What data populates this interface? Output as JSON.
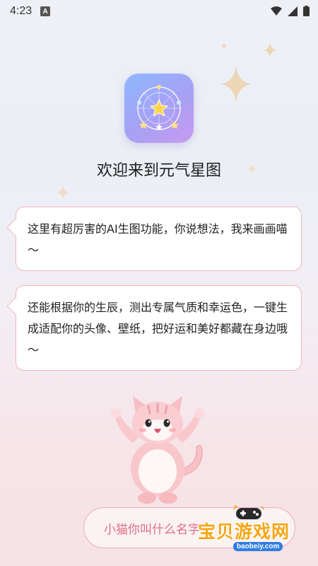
{
  "status_bar": {
    "time": "4:23",
    "notification_badge": "A",
    "icons": [
      "wifi-icon",
      "signal-icon",
      "battery-icon"
    ]
  },
  "app": {
    "logo_icon": "star-constellation-icon",
    "welcome_title": "欢迎来到元气星图"
  },
  "messages": [
    {
      "text": "这里有超厉害的AI生图功能，你说想法，我来画画喵～"
    },
    {
      "text": "还能根据你的生辰，测出专属气质和幸运色，一键生成适配你的头像、壁纸，把好运和美好都藏在身边哦～"
    }
  ],
  "mascot": {
    "icon": "cat-mascot-icon"
  },
  "ask_button": {
    "label": "小猫你叫什么名字"
  },
  "watermark": {
    "title": "宝贝游戏网",
    "url": "baobeiy.com"
  },
  "colors": {
    "accent": "#e06f86",
    "bubble_border": "#f0b6bd",
    "watermark_orange": "#f7a514"
  }
}
